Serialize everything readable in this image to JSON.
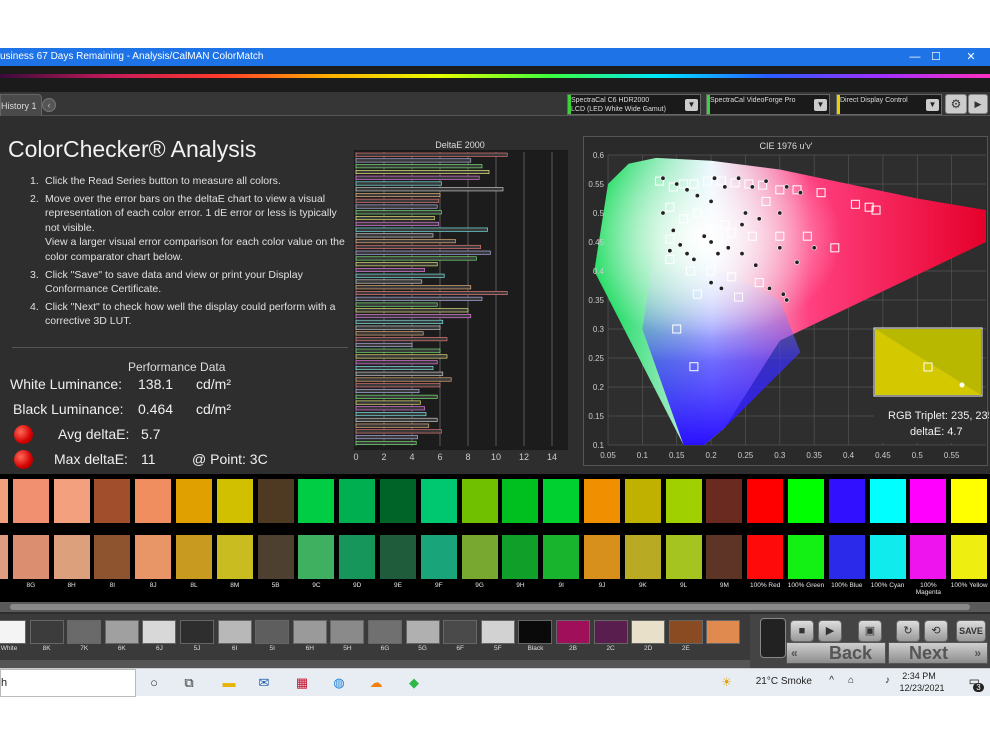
{
  "window": {
    "title": "usiness 67 Days Remaining  - Analysis/CalMAN ColorMatch",
    "minimize": "—",
    "maximize": "☐",
    "close": "✕"
  },
  "tabs": {
    "history": "History 1",
    "close_glyph": "‹"
  },
  "devices": [
    {
      "line1": "SpectraCal C6 HDR2000",
      "line2": "LCD (LED White Wide Gamut)",
      "status": "green"
    },
    {
      "line1": "SpectraCal VideoForge Pro",
      "line2": "",
      "status": "green"
    },
    {
      "line1": "Direct Display Control",
      "line2": "",
      "status": "yellow"
    }
  ],
  "page": {
    "title": "ColorChecker® Analysis",
    "steps": [
      {
        "n": "1.",
        "text": "Click the Read Series button to measure all colors."
      },
      {
        "n": "2.",
        "text": "Move over the error bars on the deltaE chart to view a visual representation of each color error. 1 dE error or less is typically not visible.\nView a larger visual error comparison for each color value on the color comparator chart below."
      },
      {
        "n": "3.",
        "text": "Click \"Save\" to save data and view or print your Display Conformance Certificate."
      },
      {
        "n": "4.",
        "text": "Click \"Next\" to check how well the display could perform with a corrective 3D LUT."
      }
    ],
    "performance": {
      "title": "Performance Data",
      "white_label": "White Luminance:",
      "white_value": "138.1",
      "white_unit": "cd/m²",
      "black_label": "Black Luminance:",
      "black_value": "0.464",
      "black_unit": "cd/m²",
      "avg_label": "Avg deltaE:",
      "avg_value": "5.7",
      "max_label": "Max deltaE:",
      "max_value": "11",
      "point_text": "@ Point: 3C"
    }
  },
  "chart_data": [
    {
      "type": "bar",
      "title": "DeltaE 2000",
      "orientation": "horizontal",
      "xlim": [
        0,
        15
      ],
      "xticks": [
        0,
        2,
        4,
        6,
        8,
        10,
        12,
        14
      ],
      "values": [
        10.8,
        8.2,
        9.0,
        9.5,
        8.8,
        6.1,
        10.5,
        6.0,
        5.9,
        5.8,
        6.1,
        5.6,
        5.9,
        9.4,
        5.5,
        7.1,
        8.9,
        9.6,
        8.6,
        5.8,
        4.9,
        6.3,
        4.7,
        8.2,
        10.8,
        9.0,
        5.8,
        8.0,
        8.2,
        6.2,
        6.0,
        4.8,
        6.5,
        4.0,
        6.0,
        6.5,
        5.8,
        5.5,
        6.2,
        6.8,
        6.0,
        4.5,
        5.8,
        4.6,
        4.9,
        5.0,
        5.8,
        5.2,
        6.1,
        4.4,
        4.3
      ]
    },
    {
      "type": "scatter",
      "title": "CIE 1976 u'v'",
      "xlim": [
        0.05,
        0.6
      ],
      "ylim": [
        0.1,
        0.6
      ],
      "xticks": [
        "0.05",
        "0.1",
        "0.15",
        "0.2",
        "0.25",
        "0.3",
        "0.35",
        "0.4",
        "0.45",
        "0.5",
        "0.55"
      ],
      "yticks": [
        "0.1",
        "0.15",
        "0.2",
        "0.25",
        "0.3",
        "0.35",
        "0.4",
        "0.45",
        "0.5",
        "0.55",
        "0.6"
      ],
      "targets": [
        [
          0.125,
          0.555
        ],
        [
          0.145,
          0.545
        ],
        [
          0.16,
          0.55
        ],
        [
          0.175,
          0.55
        ],
        [
          0.195,
          0.555
        ],
        [
          0.215,
          0.555
        ],
        [
          0.235,
          0.552
        ],
        [
          0.255,
          0.55
        ],
        [
          0.275,
          0.548
        ],
        [
          0.3,
          0.54
        ],
        [
          0.325,
          0.54
        ],
        [
          0.36,
          0.535
        ],
        [
          0.41,
          0.515
        ],
        [
          0.43,
          0.51
        ],
        [
          0.44,
          0.505
        ],
        [
          0.14,
          0.51
        ],
        [
          0.16,
          0.49
        ],
        [
          0.18,
          0.5
        ],
        [
          0.2,
          0.47
        ],
        [
          0.23,
          0.465
        ],
        [
          0.26,
          0.46
        ],
        [
          0.3,
          0.46
        ],
        [
          0.34,
          0.46
        ],
        [
          0.38,
          0.44
        ],
        [
          0.14,
          0.42
        ],
        [
          0.17,
          0.4
        ],
        [
          0.2,
          0.4
        ],
        [
          0.23,
          0.39
        ],
        [
          0.27,
          0.38
        ],
        [
          0.18,
          0.36
        ],
        [
          0.24,
          0.355
        ],
        [
          0.15,
          0.3
        ],
        [
          0.175,
          0.235
        ],
        [
          0.22,
          0.48
        ],
        [
          0.14,
          0.455
        ],
        [
          0.19,
          0.44
        ],
        [
          0.28,
          0.52
        ]
      ],
      "measured": [
        [
          0.13,
          0.56
        ],
        [
          0.15,
          0.55
        ],
        [
          0.165,
          0.54
        ],
        [
          0.205,
          0.56
        ],
        [
          0.22,
          0.545
        ],
        [
          0.24,
          0.56
        ],
        [
          0.26,
          0.545
        ],
        [
          0.28,
          0.555
        ],
        [
          0.31,
          0.545
        ],
        [
          0.33,
          0.535
        ],
        [
          0.13,
          0.5
        ],
        [
          0.145,
          0.47
        ],
        [
          0.155,
          0.445
        ],
        [
          0.165,
          0.43
        ],
        [
          0.175,
          0.42
        ],
        [
          0.19,
          0.46
        ],
        [
          0.2,
          0.45
        ],
        [
          0.21,
          0.43
        ],
        [
          0.225,
          0.44
        ],
        [
          0.245,
          0.43
        ],
        [
          0.265,
          0.41
        ],
        [
          0.3,
          0.44
        ],
        [
          0.325,
          0.415
        ],
        [
          0.35,
          0.44
        ],
        [
          0.285,
          0.37
        ],
        [
          0.305,
          0.36
        ],
        [
          0.31,
          0.35
        ],
        [
          0.2,
          0.38
        ],
        [
          0.215,
          0.37
        ],
        [
          0.14,
          0.435
        ],
        [
          0.25,
          0.5
        ],
        [
          0.27,
          0.49
        ],
        [
          0.245,
          0.48
        ],
        [
          0.3,
          0.5
        ],
        [
          0.2,
          0.52
        ],
        [
          0.18,
          0.53
        ]
      ],
      "magnifier": {
        "label_rgb": "RGB Triplet: 235, 235, 16",
        "label_de": "deltaE: 4.7"
      }
    }
  ],
  "swatches": {
    "labels": [
      "",
      "8G",
      "8H",
      "8I",
      "8J",
      "8L",
      "8M",
      "5B",
      "9C",
      "9D",
      "9E",
      "9F",
      "9G",
      "9H",
      "9I",
      "9J",
      "9K",
      "9L",
      "9M",
      "100% Red",
      "100% Green",
      "100% Blue",
      "100% Cyan",
      "100% Magenta",
      "100% Yellow"
    ],
    "target": [
      "#f0a07a",
      "#f09070",
      "#f2a07e",
      "#a04e2c",
      "#f08e60",
      "#e0a000",
      "#d0c000",
      "#4e3a22",
      "#00cc44",
      "#00b050",
      "#006428",
      "#00c870",
      "#70c000",
      "#00c020",
      "#00d030",
      "#f09000",
      "#c0b000",
      "#a0d000",
      "#6a2a20",
      "#ff0000",
      "#00ff00",
      "#3010ff",
      "#00ffff",
      "#ff00ff",
      "#ffff00"
    ],
    "measured": [
      "#e09c80",
      "#dc8e70",
      "#dca07c",
      "#8e5430",
      "#e89668",
      "#c89a20",
      "#c8bc20",
      "#4e4030",
      "#3eb060",
      "#16965a",
      "#1e5c3c",
      "#1aa47a",
      "#78a830",
      "#10a02a",
      "#18b42e",
      "#d8901c",
      "#b8aa22",
      "#a6c420",
      "#5e3426",
      "#ff0a0a",
      "#12f014",
      "#2c2aea",
      "#10ecee",
      "#ee14ee",
      "#eeee10"
    ]
  },
  "grayscale": {
    "labels": [
      "White",
      "8K",
      "7K",
      "6K",
      "6J",
      "5J",
      "6I",
      "5I",
      "6H",
      "5H",
      "6G",
      "5G",
      "6F",
      "5F",
      "Black",
      "2B",
      "2C",
      "2D",
      "2E",
      ""
    ],
    "colors": [
      "#f4f4f4",
      "#3c3c3c",
      "#6a6a6a",
      "#a0a0a0",
      "#d8d8d8",
      "#2e2e2e",
      "#b8b8b8",
      "#5e5e5e",
      "#9a9a9a",
      "#8a8a8a",
      "#707070",
      "#b0b0b0",
      "#4a4a4a",
      "#d2d2d2",
      "#0a0a0a",
      "#a0105a",
      "#5a1e4e",
      "#e8e0c8",
      "#8a4a22",
      "#e08a50"
    ]
  },
  "buttons": {
    "back": "Back",
    "next": "Next",
    "save": "SAVE"
  },
  "taskbar": {
    "search_text": "h",
    "weather": "21°C  Smoke",
    "time": "2:34 PM",
    "date": "12/23/2021",
    "notif": "3",
    "calendar_day": "31"
  }
}
